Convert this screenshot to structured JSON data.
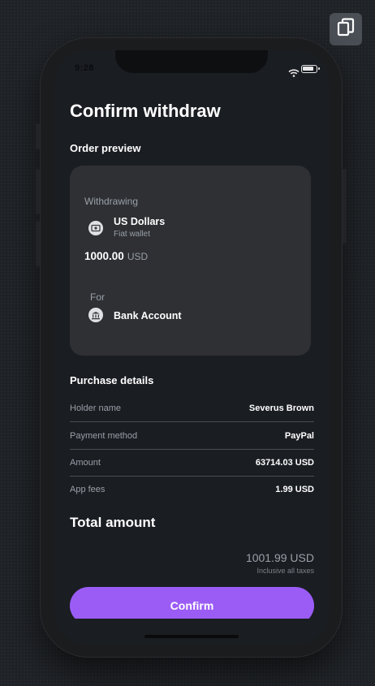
{
  "status_bar": {
    "time": "9:28"
  },
  "page": {
    "title": "Confirm withdraw"
  },
  "order_preview": {
    "section_label": "Order preview",
    "withdrawing_label": "Withdrawing",
    "currency_name": "US Dollars",
    "wallet_type": "Fiat wallet",
    "amount": "1000.00",
    "amount_currency": "USD",
    "for_label": "For",
    "destination": "Bank Account"
  },
  "purchase_details": {
    "section_label": "Purchase details",
    "rows": [
      {
        "label": "Holder name",
        "value": "Severus Brown"
      },
      {
        "label": "Payment method",
        "value": "PayPal"
      },
      {
        "label": "Amount",
        "value": "63714.03 USD"
      },
      {
        "label": "App fees",
        "value": "1.99 USD"
      }
    ]
  },
  "total": {
    "title": "Total amount",
    "amount": "1001.99 USD",
    "note": "Inclusive all taxes"
  },
  "actions": {
    "confirm_label": "Confirm"
  },
  "icons": {
    "copy": "copy-icon",
    "currency": "cash-icon",
    "bank": "bank-icon",
    "wifi": "wifi-icon",
    "battery": "battery-icon"
  },
  "colors": {
    "accent": "#9b5cf6",
    "background": "#1a1d22",
    "card": "#2e3034"
  }
}
